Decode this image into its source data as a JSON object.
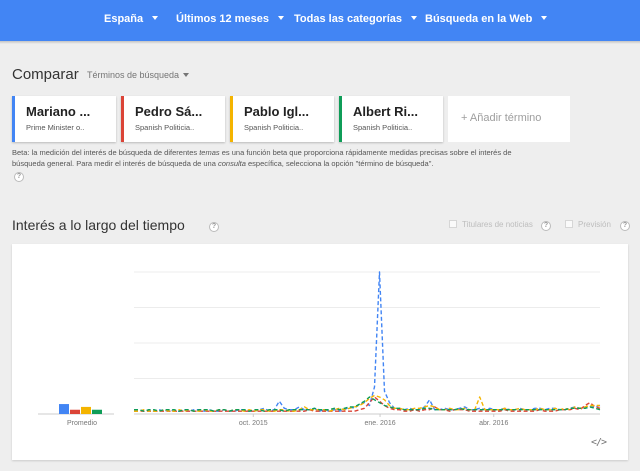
{
  "filters": [
    {
      "label": "España"
    },
    {
      "label": "Últimos 12 meses"
    },
    {
      "label": "Todas las categorías"
    },
    {
      "label": "Búsqueda en la Web"
    }
  ],
  "compare": {
    "title": "Comparar",
    "dropdown_label": "Términos de búsqueda"
  },
  "terms": [
    {
      "name": "Mariano ...",
      "subtitle": "Prime Minister o..",
      "color": "#4285f4"
    },
    {
      "name": "Pedro Sá...",
      "subtitle": "Spanish Politicia..",
      "color": "#db4437"
    },
    {
      "name": "Pablo Igl...",
      "subtitle": "Spanish Politicia..",
      "color": "#f4b400"
    },
    {
      "name": "Albert Ri...",
      "subtitle": "Spanish Politicia..",
      "color": "#0f9d58"
    }
  ],
  "add_term": "+ Añadir término",
  "beta_note": {
    "part1": "Beta: la medición del interés de búsqueda de diferentes ",
    "em1": "temas",
    "part2": " es una función beta que proporciona rápidamente medidas precisas sobre el interés de búsqueda general. Para medir el interés de búsqueda de una ",
    "em2": "consulta",
    "part3": " específica, selecciona la opción \"término de búsqueda\"."
  },
  "interest": {
    "title": "Interés a lo largo del tiempo",
    "news_headlines": "Titulares de noticias",
    "forecast": "Previsión",
    "embed": "</>"
  },
  "chart_data": {
    "type": "line",
    "x_tick_labels": [
      "oct. 2015",
      "ene. 2016",
      "abr. 2016"
    ],
    "average_label": "Promedio",
    "ylim": [
      0,
      100
    ],
    "grid": true,
    "averages": [
      {
        "term": "Mariano ...",
        "value": 7
      },
      {
        "term": "Pedro Sá...",
        "value": 3
      },
      {
        "term": "Pablo Igl...",
        "value": 5
      },
      {
        "term": "Albert Ri...",
        "value": 3
      }
    ],
    "series": [
      {
        "term": "Mariano ...",
        "color": "#4285f4",
        "values": [
          3,
          3,
          2,
          3,
          2,
          3,
          2,
          3,
          2,
          2,
          3,
          2,
          3,
          3,
          2,
          3,
          2,
          2,
          3,
          2,
          2,
          3,
          3,
          2,
          2,
          3,
          4,
          2,
          3,
          9,
          4,
          3,
          3,
          5,
          3,
          3,
          4,
          2,
          3,
          2,
          3,
          2,
          3,
          5,
          4,
          7,
          8,
          6,
          19,
          100,
          16,
          8,
          4,
          3,
          3,
          4,
          3,
          3,
          5,
          10,
          3,
          3,
          4,
          3,
          3,
          4,
          5,
          3,
          3,
          4,
          3,
          4,
          3,
          3,
          4,
          3,
          3,
          4,
          3,
          3,
          4,
          4,
          3,
          4,
          4,
          3,
          3,
          4,
          5,
          4,
          4,
          5,
          5,
          6
        ]
      },
      {
        "term": "Pedro Sá...",
        "color": "#db4437",
        "values": [
          2,
          2,
          2,
          2,
          2,
          2,
          2,
          2,
          2,
          2,
          2,
          2,
          2,
          2,
          2,
          2,
          2,
          2,
          2,
          2,
          2,
          2,
          2,
          2,
          2,
          2,
          2,
          2,
          2,
          2,
          2,
          2,
          2,
          2,
          2,
          3,
          2,
          2,
          2,
          2,
          2,
          2,
          2,
          2,
          2,
          3,
          4,
          8,
          12,
          9,
          6,
          4,
          3,
          3,
          2,
          2,
          3,
          2,
          3,
          3,
          5,
          3,
          3,
          2,
          3,
          3,
          3,
          2,
          2,
          2,
          2,
          2,
          2,
          2,
          3,
          2,
          2,
          2,
          2,
          2,
          2,
          3,
          2,
          2,
          2,
          3,
          3,
          3,
          4,
          3,
          6,
          8,
          5,
          4
        ]
      },
      {
        "term": "Pablo Igl...",
        "color": "#f4b400",
        "values": [
          2,
          2,
          3,
          2,
          2,
          2,
          3,
          2,
          2,
          3,
          2,
          3,
          2,
          2,
          3,
          2,
          2,
          3,
          3,
          2,
          3,
          3,
          2,
          3,
          2,
          3,
          3,
          2,
          2,
          3,
          3,
          2,
          2,
          3,
          5,
          3,
          3,
          3,
          3,
          2,
          3,
          4,
          3,
          4,
          5,
          6,
          8,
          11,
          13,
          12,
          10,
          6,
          4,
          4,
          3,
          3,
          4,
          4,
          5,
          6,
          5,
          3,
          3,
          4,
          3,
          3,
          4,
          3,
          3,
          12,
          3,
          3,
          3,
          3,
          4,
          3,
          3,
          4,
          3,
          3,
          3,
          4,
          3,
          3,
          4,
          3,
          4,
          3,
          5,
          4,
          5,
          6,
          6,
          6
        ]
      },
      {
        "term": "Albert Ri...",
        "color": "#0f9d58",
        "values": [
          3,
          3,
          2,
          3,
          3,
          2,
          3,
          3,
          3,
          2,
          3,
          3,
          2,
          3,
          3,
          3,
          2,
          3,
          3,
          2,
          3,
          3,
          3,
          2,
          3,
          3,
          2,
          3,
          3,
          3,
          2,
          3,
          3,
          3,
          3,
          3,
          4,
          3,
          3,
          3,
          4,
          3,
          4,
          5,
          5,
          7,
          9,
          12,
          10,
          8,
          6,
          5,
          4,
          4,
          3,
          3,
          3,
          3,
          4,
          4,
          3,
          3,
          3,
          3,
          3,
          4,
          3,
          3,
          3,
          3,
          3,
          3,
          3,
          3,
          3,
          3,
          3,
          3,
          3,
          3,
          3,
          3,
          3,
          3,
          3,
          3,
          3,
          4,
          4,
          4,
          4,
          5,
          4,
          3
        ]
      }
    ]
  }
}
